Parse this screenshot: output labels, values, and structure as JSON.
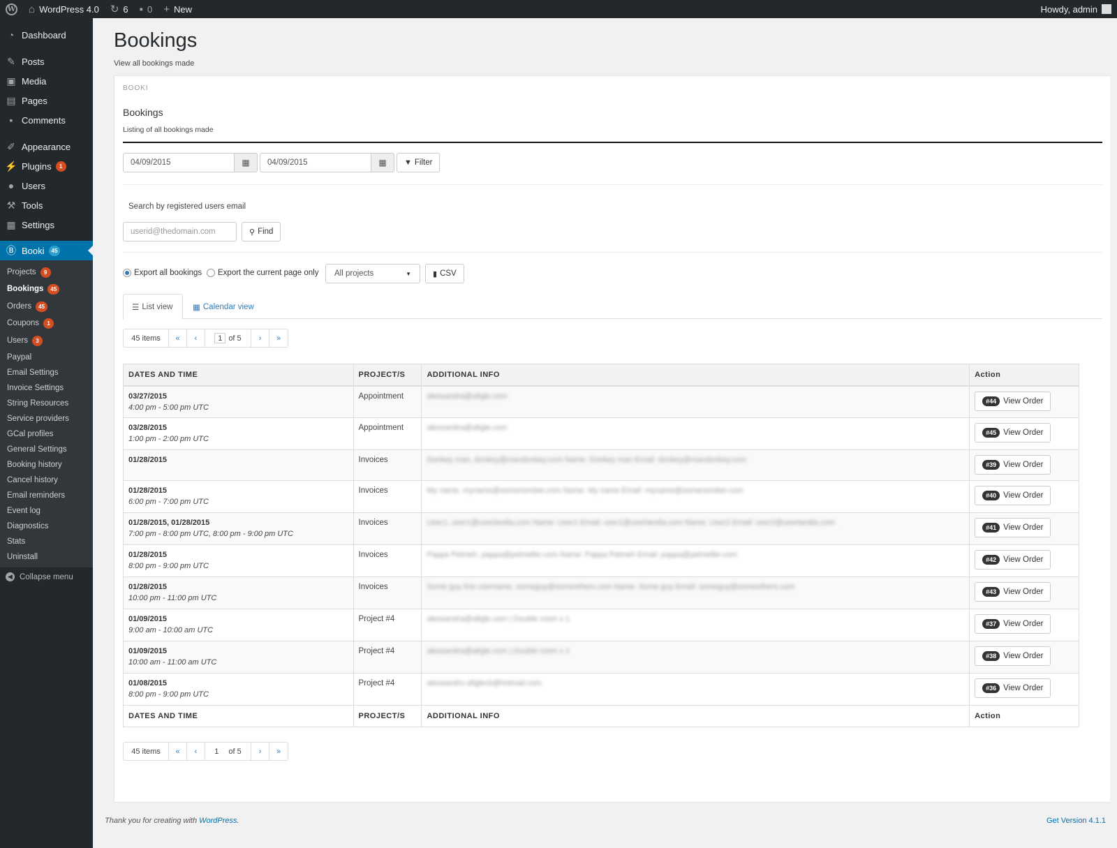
{
  "adminbar": {
    "site_name": "WordPress 4.0",
    "updates_count": "6",
    "comments_count": "0",
    "new_label": "New",
    "howdy": "Howdy, admin"
  },
  "sidebar": {
    "menu": [
      {
        "label": "Dashboard",
        "icon": "dashboard-icon"
      },
      {
        "label": "Posts",
        "icon": "pin-icon"
      },
      {
        "label": "Media",
        "icon": "media-icon"
      },
      {
        "label": "Pages",
        "icon": "pages-icon"
      },
      {
        "label": "Comments",
        "icon": "comment-icon"
      },
      {
        "label": "Appearance",
        "icon": "brush-icon"
      },
      {
        "label": "Plugins",
        "icon": "plug-icon",
        "count": "1"
      },
      {
        "label": "Users",
        "icon": "user-icon"
      },
      {
        "label": "Tools",
        "icon": "wrench-icon"
      },
      {
        "label": "Settings",
        "icon": "settings-icon"
      },
      {
        "label": "Booki",
        "icon": "booki-icon",
        "count": "45"
      }
    ],
    "submenu": [
      {
        "label": "Projects",
        "count": "9"
      },
      {
        "label": "Bookings",
        "count": "45"
      },
      {
        "label": "Orders",
        "count": "45"
      },
      {
        "label": "Coupons",
        "count": "1"
      },
      {
        "label": "Users",
        "count": "3"
      },
      {
        "label": "Paypal"
      },
      {
        "label": "Email Settings"
      },
      {
        "label": "Invoice Settings"
      },
      {
        "label": "String Resources"
      },
      {
        "label": "Service providers"
      },
      {
        "label": "GCal profiles"
      },
      {
        "label": "General Settings"
      },
      {
        "label": "Booking history"
      },
      {
        "label": "Cancel history"
      },
      {
        "label": "Email reminders"
      },
      {
        "label": "Event log"
      },
      {
        "label": "Diagnostics"
      },
      {
        "label": "Stats"
      },
      {
        "label": "Uninstall"
      }
    ],
    "collapse_label": "Collapse menu"
  },
  "page": {
    "title": "Bookings",
    "subtitle": "View all bookings made"
  },
  "panel": {
    "label": "BOOKI",
    "title": "Bookings",
    "description": "Listing of all bookings made",
    "date_from": "04/09/2015",
    "date_to": "04/09/2015",
    "filter_label": "Filter",
    "search_label": "Search by registered users email",
    "email_placeholder": "userid@thedomain.com",
    "find_label": "Find",
    "export_all_label": "Export all bookings",
    "export_page_label": "Export the current page only",
    "project_select": "All projects",
    "csv_label": "CSV",
    "tab_list": "List view",
    "tab_calendar": "Calendar view"
  },
  "pager": {
    "items": "45 items",
    "first": "«",
    "prev": "‹",
    "current": "1",
    "of": "of 5",
    "next": "›",
    "last": "»"
  },
  "table": {
    "headers": [
      "DATES AND TIME",
      "PROJECT/S",
      "ADDITIONAL INFO",
      "Action"
    ],
    "action_label": "View Order",
    "rows": [
      {
        "date": "03/27/2015",
        "time": "4:00 pm - 5:00 pm UTC",
        "project": "Appointment",
        "info": "alessandra@afigle.com",
        "order": "#44"
      },
      {
        "date": "03/28/2015",
        "time": "1:00 pm - 2:00 pm UTC",
        "project": "Appointment",
        "info": "alessandra@afigle.com",
        "order": "#45"
      },
      {
        "date": "01/28/2015",
        "time": "",
        "project": "Invoices",
        "info": "Donkey man, donkey@mandonkey.com Name: Donkey man Email: donkey@mandonkey.com",
        "order": "#39"
      },
      {
        "date": "01/28/2015",
        "time": "6:00 pm - 7:00 pm UTC",
        "project": "Invoices",
        "info": "My name, myname@somenomber.com Name: My name Email: myname@somenomber.com",
        "order": "#40"
      },
      {
        "date": "01/28/2015, 01/28/2015",
        "time": "7:00 pm - 8:00 pm UTC, 8:00 pm - 9:00 pm UTC",
        "project": "Invoices",
        "info": "User1, user1@userlandia.com Name: User1 Email: user1@userlandia.com Name: User2 Email: user2@userlandia.com",
        "order": "#41"
      },
      {
        "date": "01/28/2015",
        "time": "8:00 pm - 9:00 pm UTC",
        "project": "Invoices",
        "info": "Pappa Pelmeh, pappa@pelmeller.com Name: Pappa Pelmeh Email: pappa@pelmeller.com",
        "order": "#42"
      },
      {
        "date": "01/28/2015",
        "time": "10:00 pm - 11:00 pm UTC",
        "project": "Invoices",
        "info": "Some guy this username, someguy@someothers.com Name: Some guy Email: someguy@someothers.com",
        "order": "#43"
      },
      {
        "date": "01/09/2015",
        "time": "9:00 am - 10:00 am UTC",
        "project": "Project #4",
        "info": "alessandra@afigle.com | Double room x 1",
        "order": "#37"
      },
      {
        "date": "01/09/2015",
        "time": "10:00 am - 11:00 am UTC",
        "project": "Project #4",
        "info": "alessandra@afigle.com | Double room x 1",
        "order": "#38"
      },
      {
        "date": "01/08/2015",
        "time": "8:00 pm - 9:00 pm UTC",
        "project": "Project #4",
        "info": "alessandro.afigleck@hotmail.com",
        "order": "#36"
      }
    ]
  },
  "footer": {
    "thanks_prefix": "Thank you for creating with ",
    "thanks_link": "WordPress",
    "thanks_suffix": ".",
    "version": "Get Version 4.1.1"
  },
  "colors": {
    "sidebar_bg": "#23282d",
    "submenu_bg": "#32373c",
    "active": "#0073aa",
    "count_badge": "#d54e21",
    "link": "#337ab7"
  }
}
